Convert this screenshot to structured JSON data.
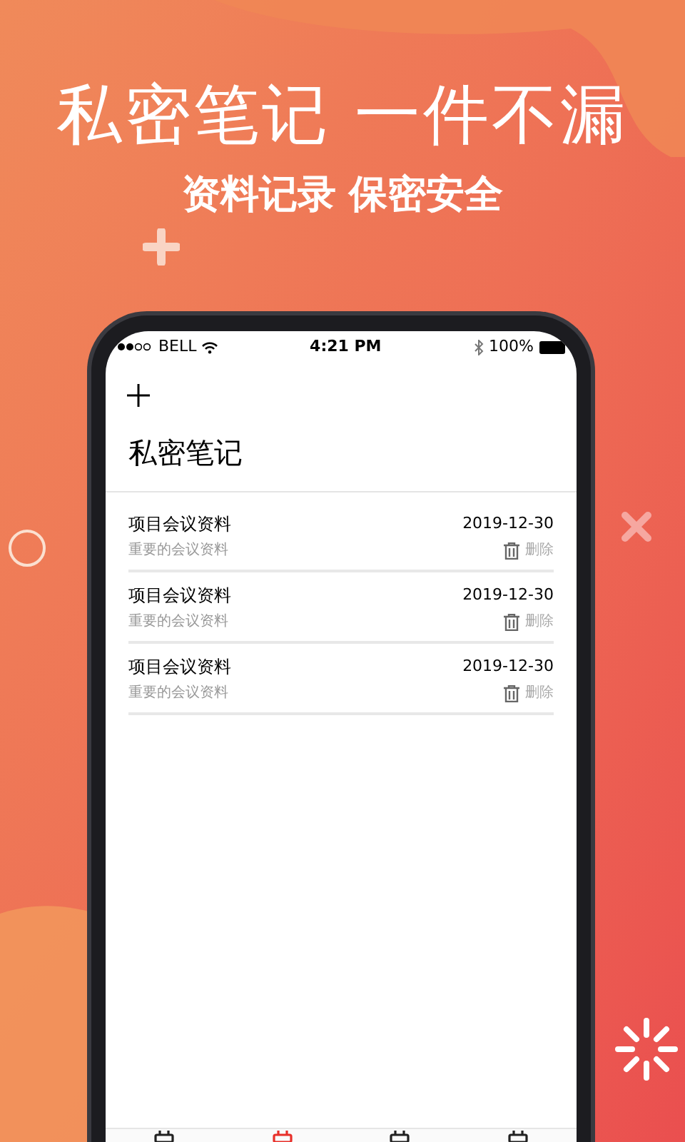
{
  "headline": "私密笔记 一件不漏",
  "subheadline": "资料记录 保密安全",
  "status_bar": {
    "carrier": "BELL",
    "time": "4:21 PM",
    "battery": "100%"
  },
  "page_title": "私密笔记",
  "notes": [
    {
      "title": "项目会议资料",
      "date": "2019-12-30",
      "summary": "重要的会议资料",
      "delete_label": "删除"
    },
    {
      "title": "项目会议资料",
      "date": "2019-12-30",
      "summary": "重要的会议资料",
      "delete_label": "删除"
    },
    {
      "title": "项目会议资料",
      "date": "2019-12-30",
      "summary": "重要的会议资料",
      "delete_label": "删除"
    }
  ],
  "tabs": [
    {
      "selected": false
    },
    {
      "selected": true
    },
    {
      "selected": false
    },
    {
      "selected": false
    }
  ]
}
